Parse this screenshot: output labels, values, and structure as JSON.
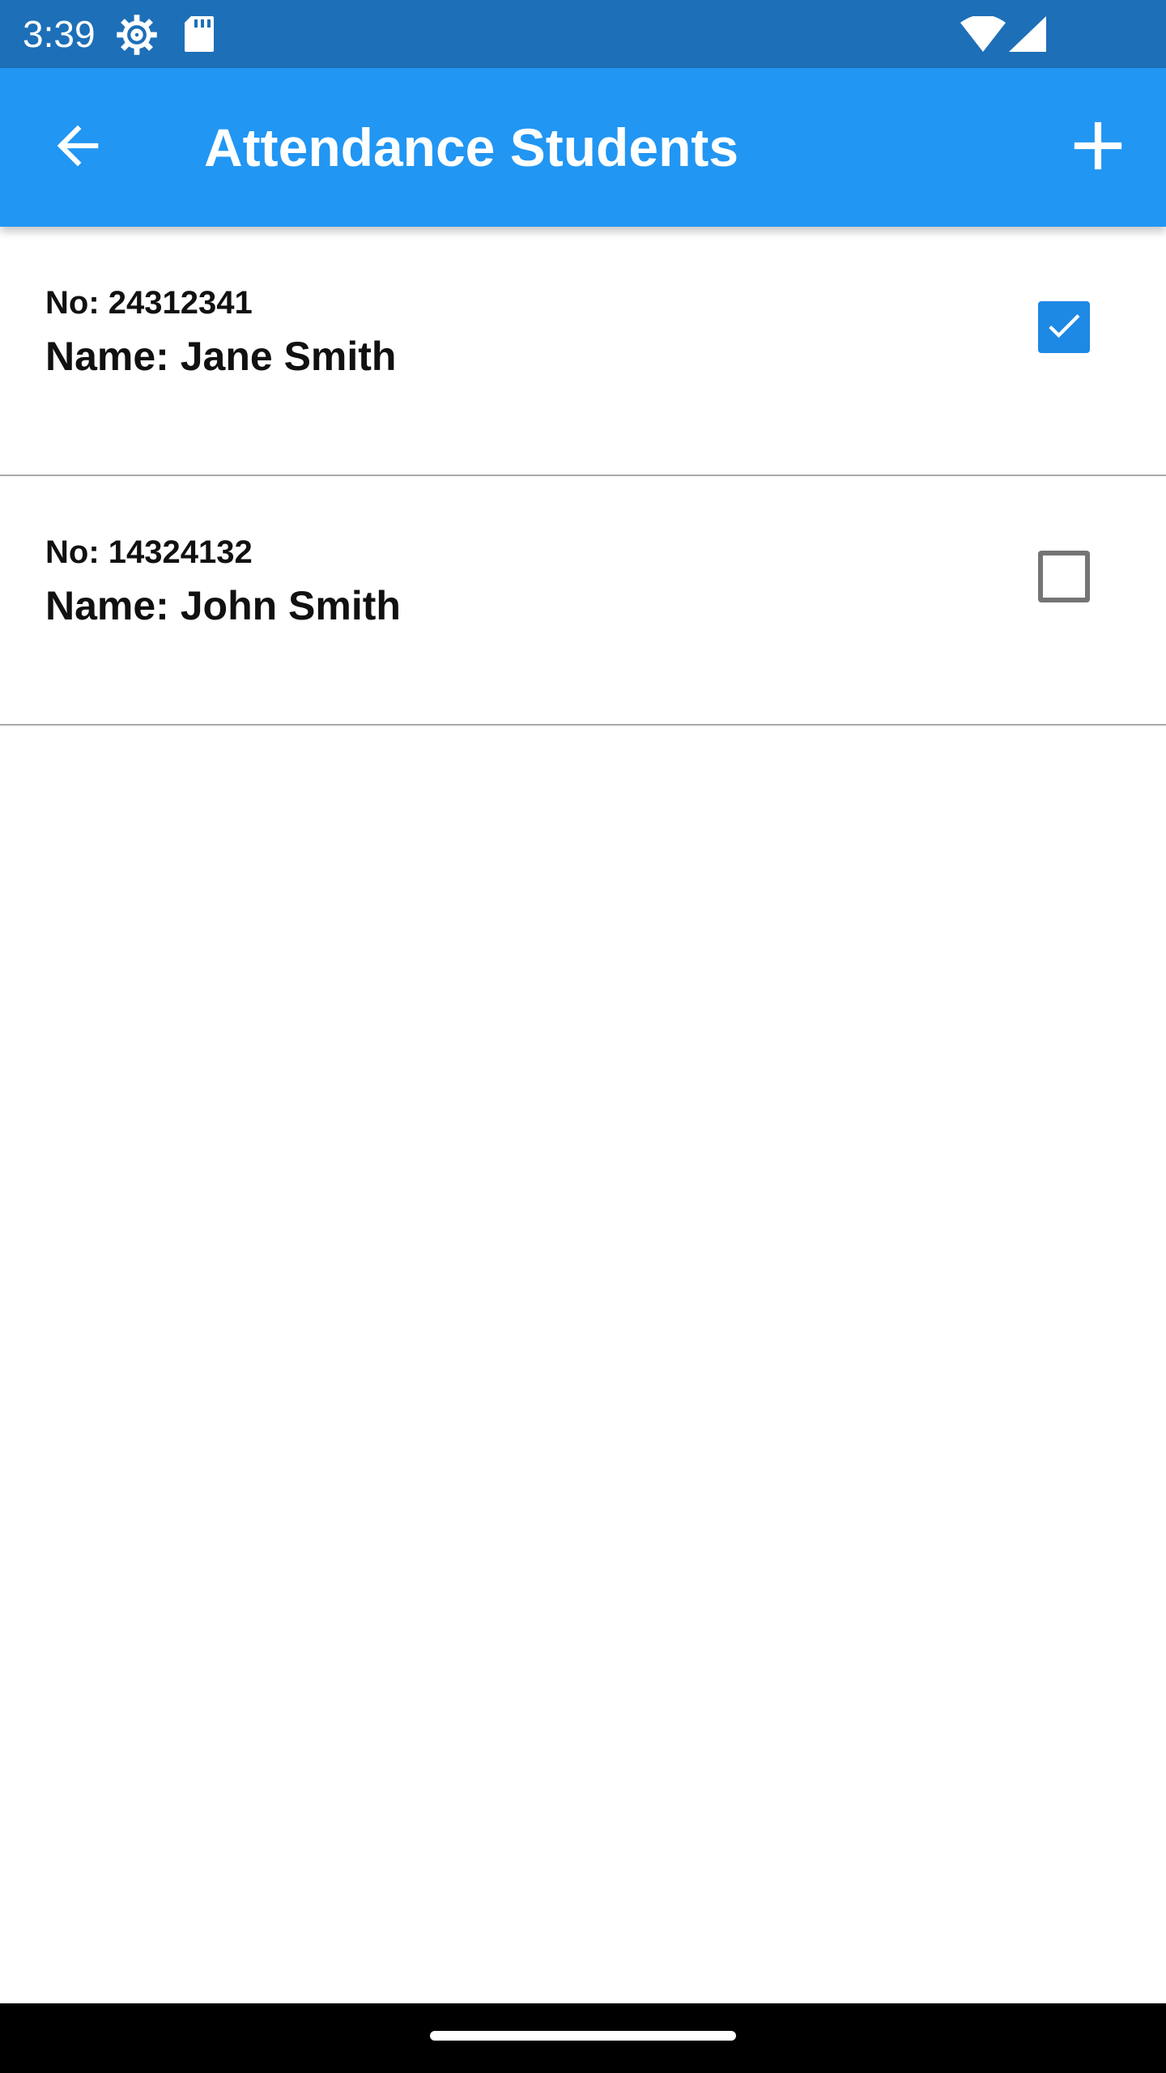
{
  "status_bar": {
    "time": "3:39",
    "icons": [
      "gear-icon",
      "sd-card-icon",
      "wifi-icon",
      "signal-icon"
    ]
  },
  "app_bar": {
    "title": "Attendance Students",
    "back_icon": "arrow-left-icon",
    "add_icon": "plus-icon",
    "color": "#2196f3"
  },
  "students": [
    {
      "number_text": "No: 24312341",
      "name_text": "Name: Jane Smith",
      "checked": true
    },
    {
      "number_text": "No: 14324132",
      "name_text": "Name: John Smith",
      "checked": false
    }
  ],
  "colors": {
    "status_bar": "#1d6fb8",
    "checkbox_checked": "#1e88e5",
    "checkbox_unchecked_border": "#757575"
  }
}
